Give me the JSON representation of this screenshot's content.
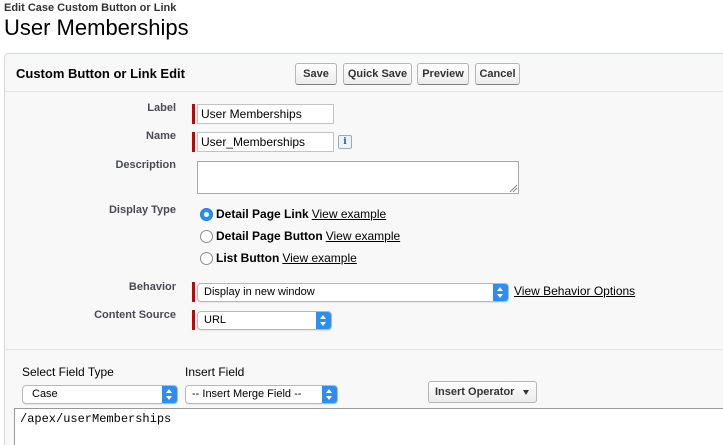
{
  "header": {
    "subtitle": "Edit Case Custom Button or Link",
    "title": "User Memberships"
  },
  "panel": {
    "title": "Custom Button or Link Edit",
    "buttons": {
      "save": "Save",
      "quick_save": "Quick Save",
      "preview": "Preview",
      "cancel": "Cancel"
    }
  },
  "form": {
    "label": {
      "label": "Label",
      "value": "User Memberships"
    },
    "name": {
      "label": "Name",
      "value": "User_Memberships",
      "info_icon": "info-icon"
    },
    "description": {
      "label": "Description",
      "value": ""
    },
    "display_type": {
      "label": "Display Type",
      "options": [
        {
          "label": "Detail Page Link",
          "link": "View example",
          "selected": true
        },
        {
          "label": "Detail Page Button",
          "link": "View example",
          "selected": false
        },
        {
          "label": "List Button",
          "link": "View example",
          "selected": false
        }
      ]
    },
    "behavior": {
      "label": "Behavior",
      "value": "Display in new window",
      "link": "View Behavior Options"
    },
    "content_source": {
      "label": "Content Source",
      "value": "URL"
    }
  },
  "formula": {
    "select_field_type_label": "Select Field Type",
    "select_field_type_value": "Case",
    "insert_field_label": "Insert Field",
    "insert_field_value": "-- Insert Merge Field --",
    "insert_operator": "Insert Operator",
    "content": "/apex/userMemberships"
  },
  "colors": {
    "required_bar": "#cc0000",
    "select_accent": "#2c8df7",
    "panel_bg": "#f8f8f8"
  }
}
